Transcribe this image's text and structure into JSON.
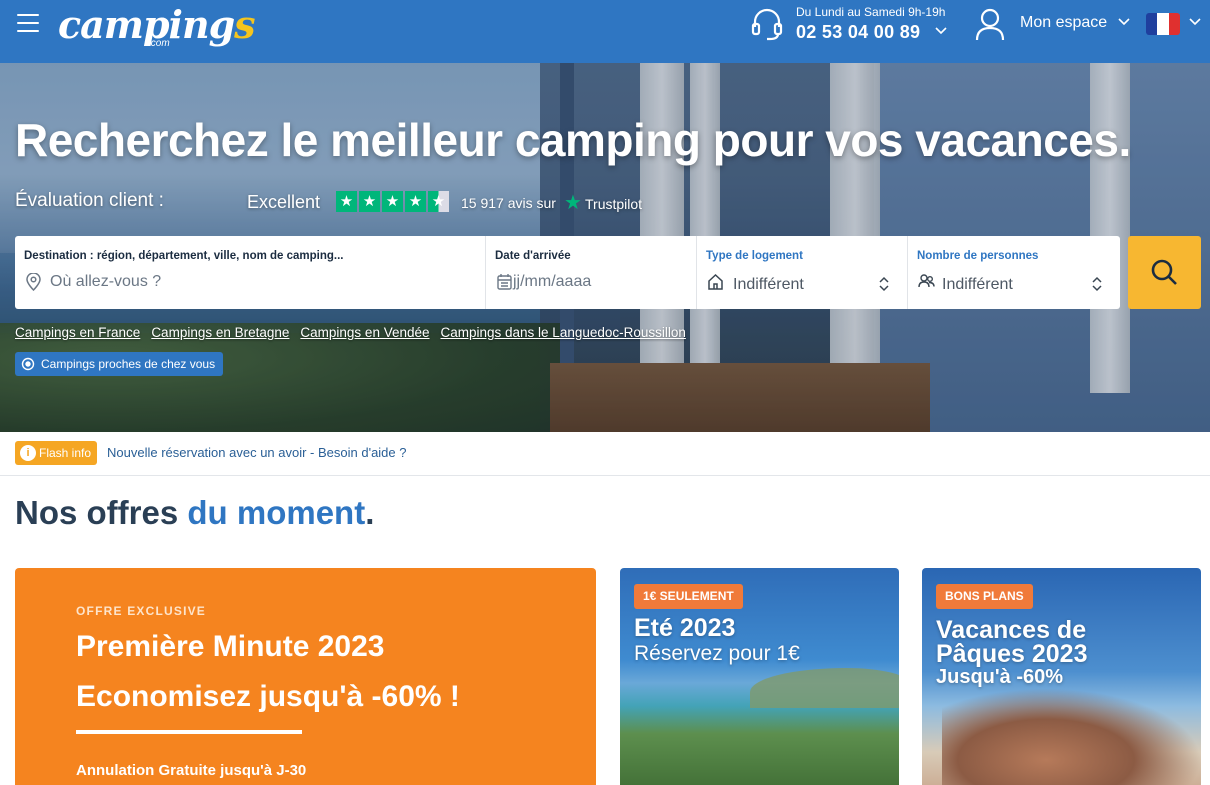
{
  "header": {
    "logo_text": "campings",
    "logo_sub": ".com",
    "phone_hours": "Du Lundi au Samedi 9h-19h",
    "phone_number": "02 53 04 00 89",
    "account_label": "Mon espace",
    "flag_colors": [
      "#1f3f9e",
      "#ffffff",
      "#e0302f"
    ],
    "icons": [
      "menu-icon",
      "headset-icon",
      "user-icon",
      "chevron-down-icon"
    ]
  },
  "hero": {
    "title": "Recherchez le meilleur camping pour vos vacances.",
    "rating_label": "Évaluation client :",
    "rating_word": "Excellent",
    "stars": 4.5,
    "review_count": "15 917 avis sur",
    "trustpilot": "Trustpilot"
  },
  "search": {
    "destination_label": "Destination : région, département, ville, nom de camping...",
    "destination_placeholder": "Où allez-vous ?",
    "date_label": "Date d'arrivée",
    "date_placeholder": "jj/mm/aaaa",
    "housing_label": "Type de logement",
    "housing_value": "Indifférent",
    "persons_label": "Nombre de personnes",
    "persons_value": "Indifférent"
  },
  "quick_links": [
    "Campings en France",
    "Campings en Bretagne",
    "Campings en Vendée",
    "Campings dans le Languedoc-Roussillon"
  ],
  "near_button": "Campings proches de chez vous",
  "flash": {
    "badge": "Flash info",
    "text": "Nouvelle réservation avec un avoir - Besoin d'aide ?"
  },
  "offers": {
    "title_start": "Nos offres ",
    "title_highlight": "du moment",
    "title_end": ".",
    "card_exclusive": {
      "kicker": "OFFRE EXCLUSIVE",
      "line1": "Première Minute 2023",
      "line2": "Economisez jusqu'à -60% !",
      "line3": "Annulation Gratuite jusqu'à J-30"
    },
    "card_summer": {
      "tag": "1€ SEULEMENT",
      "title": "Eté 2023",
      "subtitle": "Réservez pour 1€"
    },
    "card_easter": {
      "tag": "BONS PLANS",
      "line1": "Vacances de",
      "line2": "Pâques 2023",
      "line3": "Jusqu'à -60%"
    }
  },
  "colors": {
    "brand_blue": "#2f76c2",
    "search_yellow": "#f7b731",
    "offer_orange": "#f5841f",
    "trustpilot_green": "#00b67a"
  }
}
